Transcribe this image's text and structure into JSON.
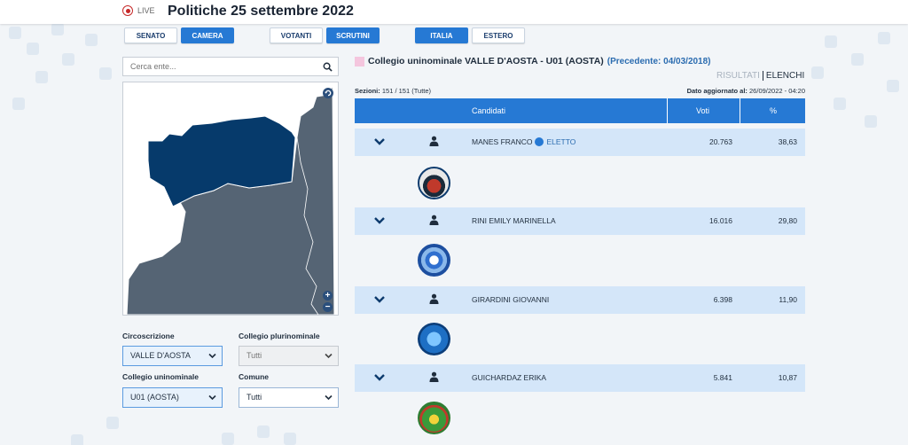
{
  "header": {
    "live_label": "LIVE",
    "title": "Politiche 25 settembre 2022"
  },
  "toggles": {
    "chamber": [
      {
        "label": "SENATO",
        "active": false
      },
      {
        "label": "CAMERA",
        "active": true
      }
    ],
    "data": [
      {
        "label": "VOTANTI",
        "active": false
      },
      {
        "label": "SCRUTINI",
        "active": true
      }
    ],
    "area": [
      {
        "label": "ITALIA",
        "active": true
      },
      {
        "label": "ESTERO",
        "active": false
      }
    ]
  },
  "search": {
    "placeholder": "Cerca ente..."
  },
  "filters": {
    "circoscrizione": {
      "label": "Circoscrizione",
      "value": "VALLE D'AOSTA"
    },
    "plurinominale": {
      "label": "Collegio plurinominale",
      "value": "Tutti"
    },
    "uninominale": {
      "label": "Collegio uninominale",
      "value": "U01 (AOSTA)"
    },
    "comune": {
      "label": "Comune",
      "value": "Tutti"
    }
  },
  "results": {
    "heading": "Collegio uninominale VALLE D'AOSTA - U01 (AOSTA)",
    "previous": "(Precedente: 04/03/2018)",
    "tab_results": "RISULTATI",
    "tab_lists": "ELENCHI",
    "sections_label": "Sezioni:",
    "sections_value": "151 / 151 (Tutte)",
    "updated_label": "Dato aggiornato al:",
    "updated_value": "26/09/2022 - 04:20",
    "columns": {
      "candidates": "Candidati",
      "votes": "Voti",
      "pct": "%"
    },
    "candidates": [
      {
        "name": "MANES FRANCO",
        "status": "ELETTO",
        "votes": "20.763",
        "pct": "38,63"
      },
      {
        "name": "RINI EMILY MARINELLA",
        "status": "",
        "votes": "16.016",
        "pct": "29,80"
      },
      {
        "name": "GIRARDINI GIOVANNI",
        "status": "",
        "votes": "6.398",
        "pct": "11,90"
      },
      {
        "name": "GUICHARDAZ ERIKA",
        "status": "",
        "votes": "5.841",
        "pct": "10,87"
      }
    ]
  },
  "colors": {
    "primary": "#2679d4",
    "row_bg": "#d4e6f9",
    "map_selected": "#063a6b",
    "map_other": "#556474"
  },
  "icons": [
    "live-icon",
    "search-icon",
    "refresh-icon",
    "zoom-in-icon",
    "zoom-out-icon",
    "chevron-down-icon",
    "person-icon",
    "verified-icon"
  ]
}
